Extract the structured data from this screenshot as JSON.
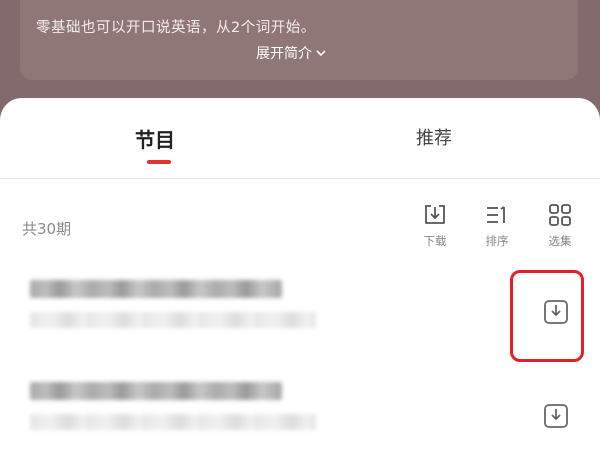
{
  "intro": {
    "text": "零基础也可以开口说英语，从2个词开始。",
    "expand_label": "展开简介"
  },
  "tabs": [
    {
      "label": "节目",
      "active": true
    },
    {
      "label": "推荐",
      "active": false
    }
  ],
  "list_header": {
    "count_text": "共30期",
    "tools": {
      "download": {
        "label": "下载",
        "icon": "download-icon"
      },
      "sort": {
        "label": "排序",
        "icon": "sort-icon"
      },
      "select": {
        "label": "选集",
        "icon": "grid-icon"
      }
    }
  },
  "episodes": [
    {
      "icon": "download-icon",
      "highlighted": true
    },
    {
      "icon": "download-icon",
      "highlighted": false
    }
  ],
  "colors": {
    "accent": "#e0342d",
    "highlight": "#e41f28",
    "header_bg": "#836a6c"
  }
}
